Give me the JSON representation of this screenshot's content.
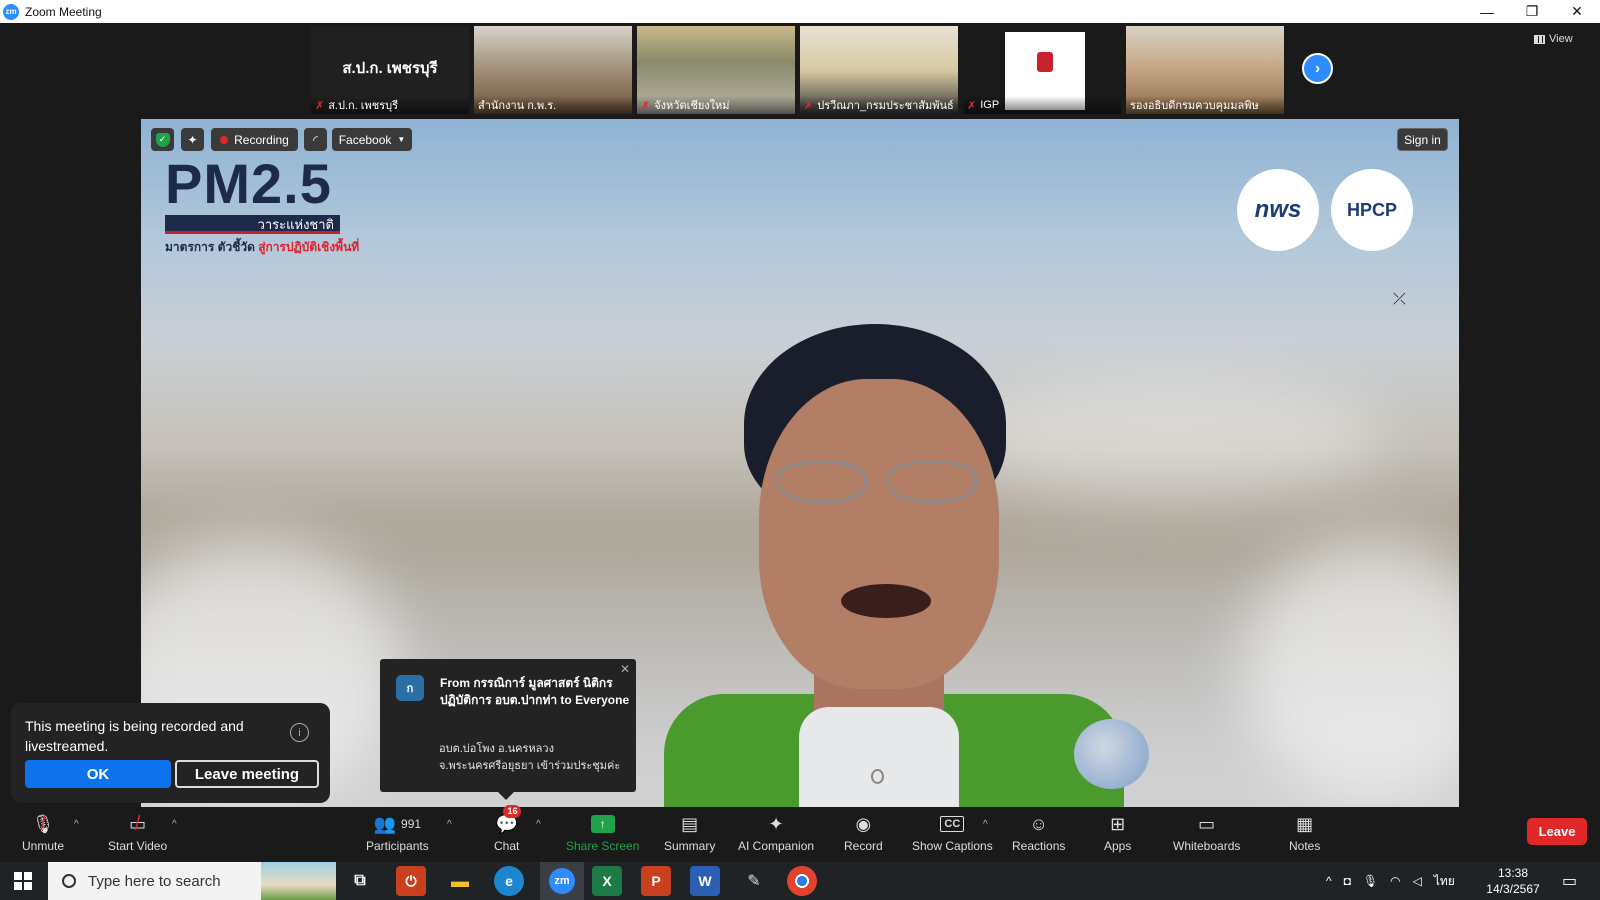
{
  "window": {
    "title": "Zoom Meeting",
    "logo_text": "zm",
    "minimize": "—",
    "maximize": "❐",
    "close": "✕"
  },
  "filmstrip": {
    "tiles": [
      {
        "name": "ส.ป.ก. เพชรบุรี",
        "display": "ส.ป.ก. เพชรบุรี",
        "muted": true
      },
      {
        "name": "สำนักงาน ก.พ.ร.",
        "muted": false
      },
      {
        "name": "จังหวัดเชียงใหม่",
        "muted": true
      },
      {
        "name": "ปรวีณภา_กรมประชาสัมพันธ์",
        "muted": true
      },
      {
        "name": "IGP",
        "muted": true
      },
      {
        "name": "รองอธิบดีกรมควบคุมมลพิษ",
        "muted": false
      }
    ],
    "next_icon": "chevron-right-icon",
    "view_label": "View"
  },
  "video": {
    "recording_label": "Recording",
    "facebook_label": "Facebook",
    "sign_in_label": "Sign in",
    "pm_logo": {
      "title": "PM2.5",
      "bar": "วาระแห่งชาติ",
      "sub_prefix": "มาตรการ ตัวชี้วัด ",
      "sub_highlight": "สู่การปฏิบัติเชิงพื้นที่"
    },
    "logo_nws": "nws",
    "logo_hp": "HPCP"
  },
  "chat_popup": {
    "avatar": "ก",
    "from": "From กรรณิการ์ มูลศาสตร์ นิติกรปฏิบัติการ อบต.ปากท่า to Everyone",
    "message": "อบต.บ่อโพง อ.นครหลวง จ.พระนครศรีอยุธยา เข้าร่วมประชุมค่ะ"
  },
  "notice": {
    "text": "This meeting is being recorded and livestreamed.",
    "ok": "OK",
    "leave": "Leave meeting"
  },
  "toolbar": {
    "unmute": "Unmute",
    "start_video": "Start Video",
    "participants": "Participants",
    "participants_count": "991",
    "chat": "Chat",
    "chat_badge": "16",
    "share_screen": "Share Screen",
    "summary": "Summary",
    "ai_companion": "AI Companion",
    "record": "Record",
    "show_captions": "Show Captions",
    "cc": "CC",
    "reactions": "Reactions",
    "apps": "Apps",
    "whiteboards": "Whiteboards",
    "notes": "Notes",
    "leave": "Leave"
  },
  "taskbar": {
    "search_placeholder": "Type here to search",
    "lang": "ไทย",
    "time": "13:38",
    "date": "14/3/2567"
  },
  "colors": {
    "accent_blue": "#0e72ed",
    "danger_red": "#e02828",
    "share_green": "#1fa34a"
  }
}
